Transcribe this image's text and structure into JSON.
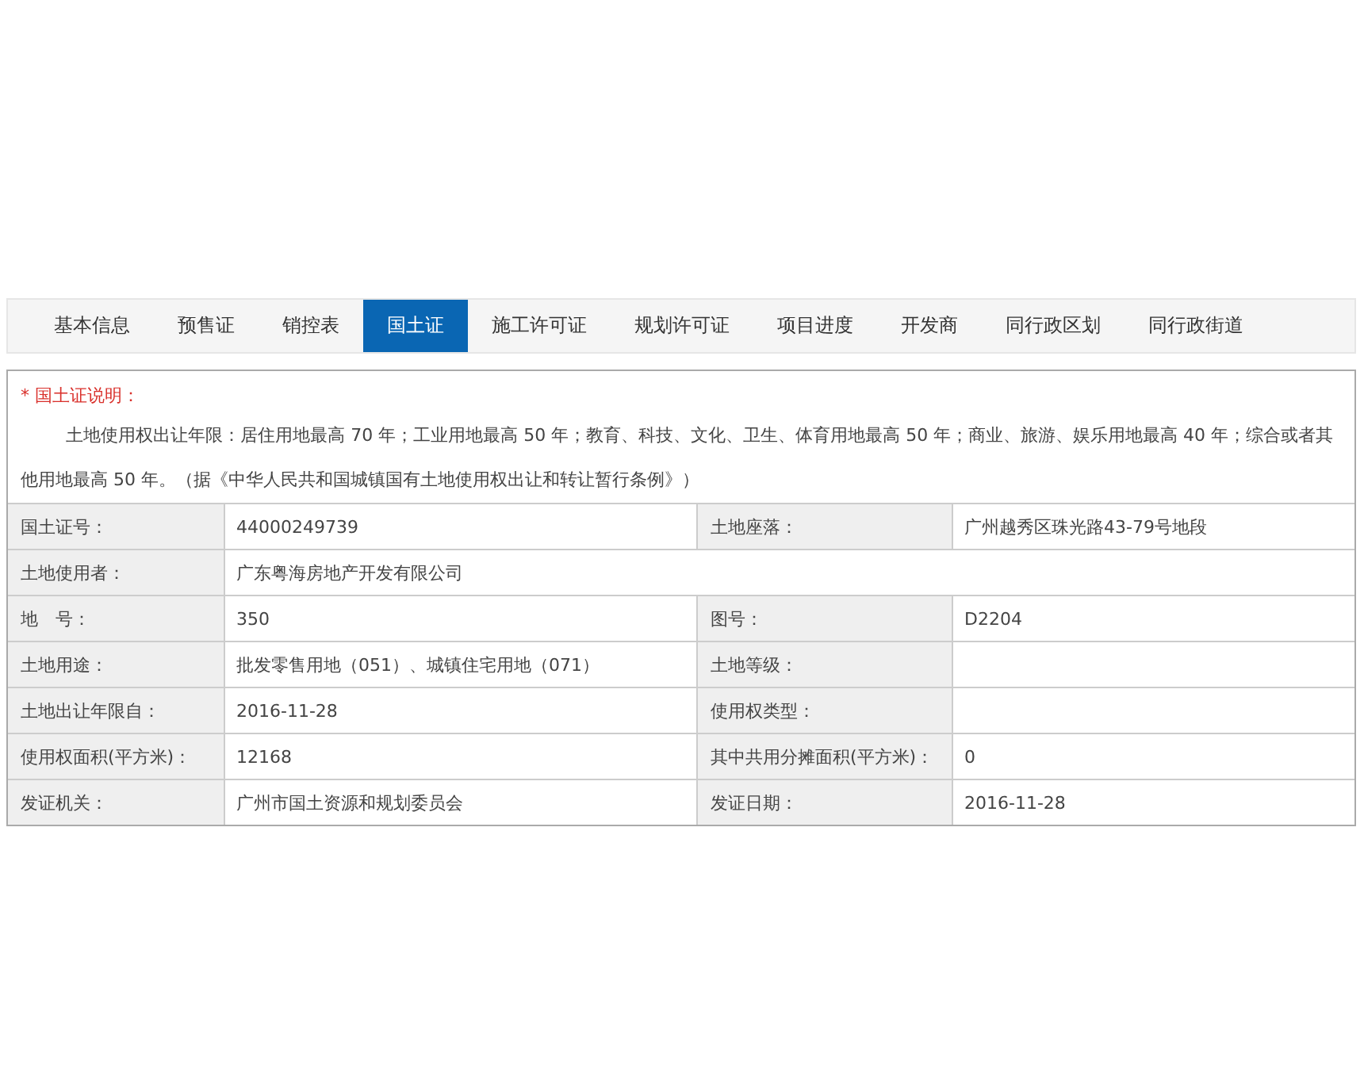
{
  "tabs": [
    {
      "label": "基本信息",
      "selected": false
    },
    {
      "label": "预售证",
      "selected": false
    },
    {
      "label": "销控表",
      "selected": false
    },
    {
      "label": "国土证",
      "selected": true
    },
    {
      "label": "施工许可证",
      "selected": false
    },
    {
      "label": "规划许可证",
      "selected": false
    },
    {
      "label": "项目进度",
      "selected": false
    },
    {
      "label": "开发商",
      "selected": false
    },
    {
      "label": "同行政区划",
      "selected": false
    },
    {
      "label": "同行政街道",
      "selected": false
    }
  ],
  "notice": {
    "title": "* 国土证说明：",
    "text": "土地使用权出让年限：居住用地最高 70 年；工业用地最高 50 年；教育、科技、文化、卫生、体育用地最高 50 年；商业、旅游、娱乐用地最高 40 年；综合或者其他用地最高 50 年。（据《中华人民共和国城镇国有土地使用权出让和转让暂行条例》）"
  },
  "table": {
    "rows": [
      {
        "cells": [
          {
            "label": "国土证号：",
            "value": "44000249739"
          },
          {
            "label": "土地座落：",
            "value": "广州越秀区珠光路43-79号地段"
          }
        ]
      },
      {
        "cells": [
          {
            "label": "土地使用者：",
            "value": "广东粤海房地产开发有限公司"
          }
        ]
      },
      {
        "cells": [
          {
            "label": "地　号：",
            "value": "350"
          },
          {
            "label": "图号：",
            "value": "D2204"
          }
        ]
      },
      {
        "cells": [
          {
            "label": "土地用途：",
            "value": "批发零售用地（051）、城镇住宅用地（071）"
          },
          {
            "label": "土地等级："
          }
        ]
      },
      {
        "cells": [
          {
            "label": "土地出让年限自：",
            "value": "2016-11-28"
          },
          {
            "label": "使用权类型："
          }
        ]
      },
      {
        "cells": [
          {
            "label": "使用权面积(平方米)：",
            "value": "12168"
          },
          {
            "label": "其中共用分摊面积(平方米)：",
            "value": "0"
          }
        ]
      },
      {
        "cells": [
          {
            "label": "发证机关：",
            "value": "广州市国土资源和规划委员会"
          },
          {
            "label": "发证日期：",
            "value": "2016-11-28"
          }
        ]
      }
    ]
  }
}
